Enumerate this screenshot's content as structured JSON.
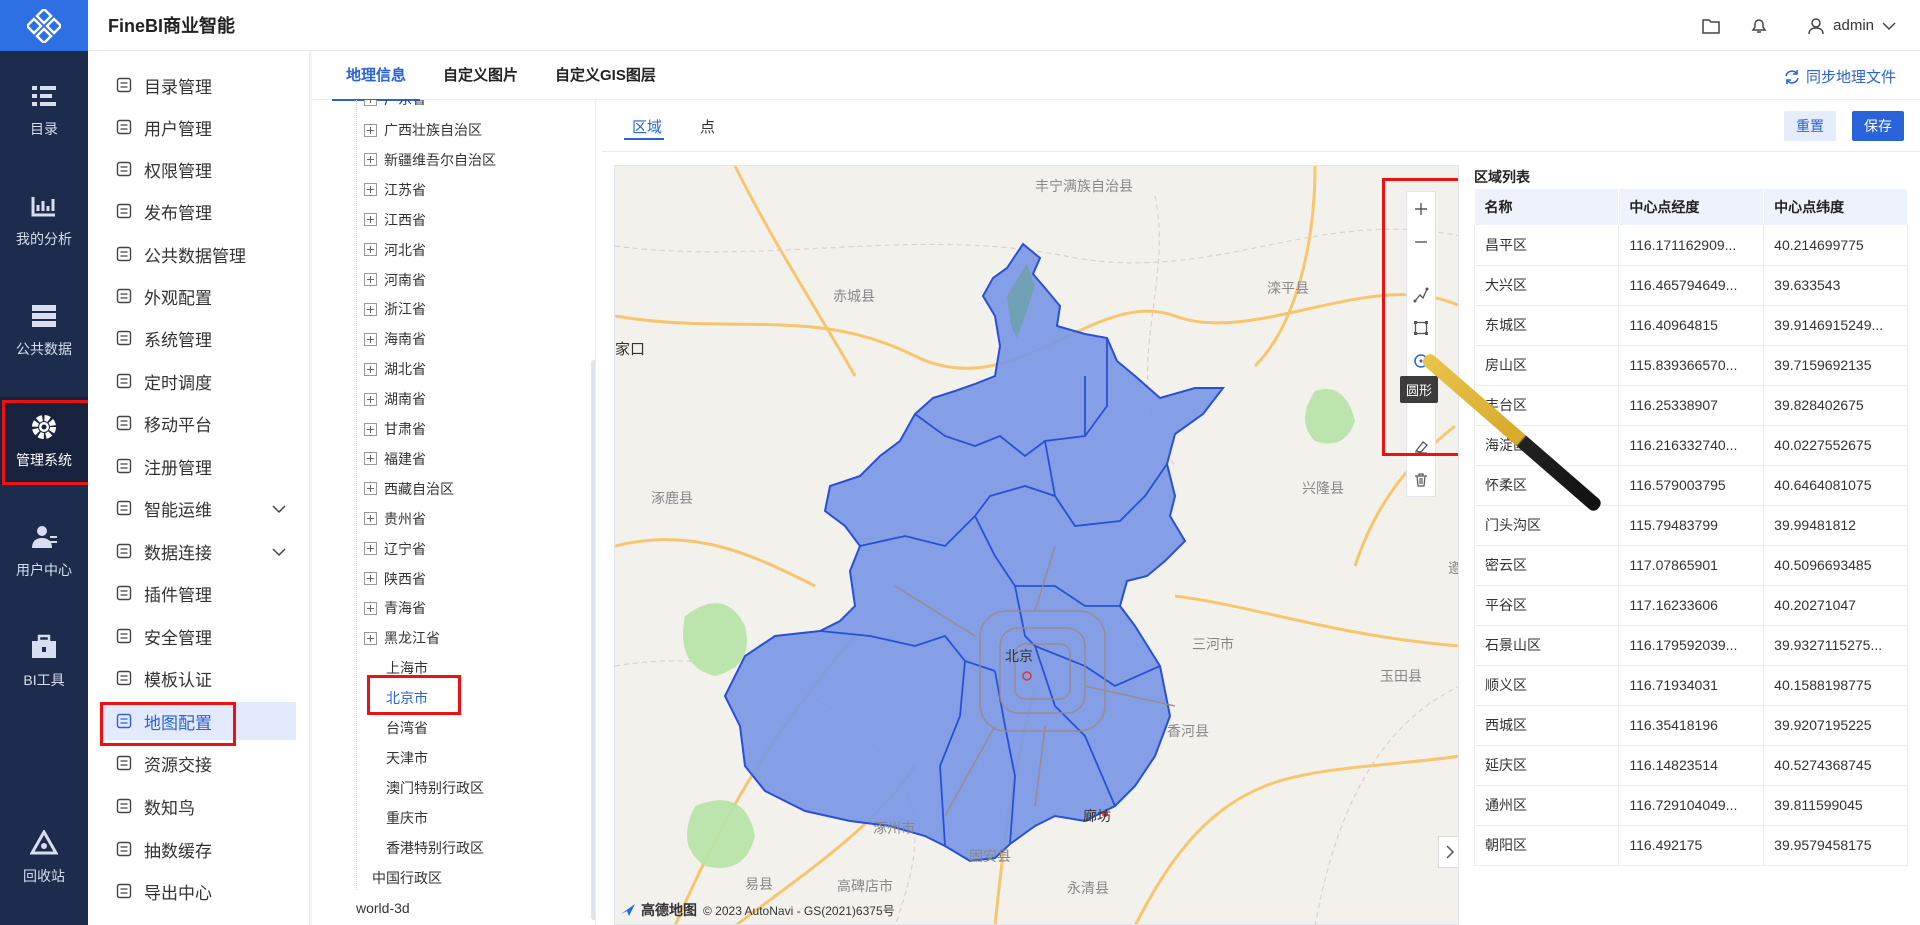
{
  "app": {
    "name": "FineBI商业智能"
  },
  "header": {
    "username": "admin"
  },
  "rail": [
    {
      "label": "目录",
      "icon": "directory-icon"
    },
    {
      "label": "我的分析",
      "icon": "analysis-icon"
    },
    {
      "label": "公共数据",
      "icon": "public-data-icon"
    },
    {
      "label": "管理系统",
      "icon": "gear-icon"
    },
    {
      "label": "用户中心",
      "icon": "user-center-icon"
    },
    {
      "label": "BI工具",
      "icon": "toolbox-icon"
    },
    {
      "label": "回收站",
      "icon": "recycle-icon"
    }
  ],
  "sidebar": [
    {
      "label": "目录管理",
      "icon": "list-icon"
    },
    {
      "label": "用户管理",
      "icon": "user-icon"
    },
    {
      "label": "权限管理",
      "icon": "shield-icon"
    },
    {
      "label": "发布管理",
      "icon": "publish-icon"
    },
    {
      "label": "公共数据管理",
      "icon": "briefcase-icon"
    },
    {
      "label": "外观配置",
      "icon": "paint-icon"
    },
    {
      "label": "系统管理",
      "icon": "gear-icon"
    },
    {
      "label": "定时调度",
      "icon": "clock-icon"
    },
    {
      "label": "移动平台",
      "icon": "mobile-icon"
    },
    {
      "label": "注册管理",
      "icon": "register-icon"
    },
    {
      "label": "智能运维",
      "icon": "ops-icon"
    },
    {
      "label": "数据连接",
      "icon": "link-icon"
    },
    {
      "label": "插件管理",
      "icon": "puzzle-icon"
    },
    {
      "label": "安全管理",
      "icon": "security-icon"
    },
    {
      "label": "模板认证",
      "icon": "certificate-icon"
    },
    {
      "label": "地图配置",
      "icon": "map-icon"
    },
    {
      "label": "资源交接",
      "icon": "handover-icon"
    },
    {
      "label": "数知鸟",
      "icon": "copy-icon"
    },
    {
      "label": "抽数缓存",
      "icon": "cache-icon"
    },
    {
      "label": "导出中心",
      "icon": "export-icon"
    }
  ],
  "tabs": [
    "地理信息",
    "自定义图片",
    "自定义GIS图层"
  ],
  "sync_label": "同步地理文件",
  "tree": {
    "top_partial": "广东省",
    "provinces": [
      "广西壮族自治区",
      "新疆维吾尔自治区",
      "江苏省",
      "江西省",
      "河北省",
      "河南省",
      "浙江省",
      "海南省",
      "湖北省",
      "湖南省",
      "甘肃省",
      "福建省",
      "西藏自治区",
      "贵州省",
      "辽宁省",
      "陕西省",
      "青海省",
      "黑龙江省"
    ],
    "leaves": [
      "上海市",
      "北京市",
      "台湾省",
      "天津市",
      "澳门特别行政区",
      "重庆市",
      "香港特别行政区"
    ],
    "root_child": "中国行政区",
    "world": "world-3d"
  },
  "editor": {
    "subtab_area": "区域",
    "subtab_point": "点",
    "reset": "重置",
    "save": "保存",
    "tooltip": "圆形"
  },
  "map": {
    "labels": [
      "丰宁满族自治县",
      "赤城县",
      "滦平县",
      "家口",
      "涿鹿县",
      "兴隆县",
      "北京",
      "三河市",
      "玉田县",
      "香河县",
      "涿州市",
      "廊坊",
      "固安县",
      "高碑店市",
      "永清县",
      "易县",
      "遵"
    ],
    "attribution": "© 2023 AutoNavi - GS(2021)6375号",
    "provider": "高德地图"
  },
  "region_list": {
    "title": "区域列表",
    "columns": [
      "名称",
      "中心点经度",
      "中心点纬度"
    ],
    "rows": [
      [
        "昌平区",
        "116.171162909...",
        "40.214699775"
      ],
      [
        "大兴区",
        "116.465794649...",
        "39.633543"
      ],
      [
        "东城区",
        "116.40964815",
        "39.9146915249..."
      ],
      [
        "房山区",
        "115.839366570...",
        "39.7159692135"
      ],
      [
        "丰台区",
        "116.25338907",
        "39.828402675"
      ],
      [
        "海淀区",
        "116.216332740...",
        "40.0227552675"
      ],
      [
        "怀柔区",
        "116.579003795",
        "40.6464081075"
      ],
      [
        "门头沟区",
        "115.79483799",
        "39.99481812"
      ],
      [
        "密云区",
        "117.07865901",
        "40.5096693485"
      ],
      [
        "平谷区",
        "117.16233606",
        "40.20271047"
      ],
      [
        "石景山区",
        "116.179592039...",
        "39.9327115275..."
      ],
      [
        "顺义区",
        "116.71934031",
        "40.1588198775"
      ],
      [
        "西城区",
        "116.35418196",
        "39.9207195225"
      ],
      [
        "延庆区",
        "116.14823514",
        "40.5274368745"
      ],
      [
        "通州区",
        "116.729104049...",
        "39.811599045"
      ],
      [
        "朝阳区",
        "116.492175",
        "39.9579458175"
      ]
    ]
  },
  "colors": {
    "accent": "#2962d9",
    "rail": "#1d2b4d",
    "highlight": "#ee1111",
    "region_fill": "#7b98e4"
  }
}
